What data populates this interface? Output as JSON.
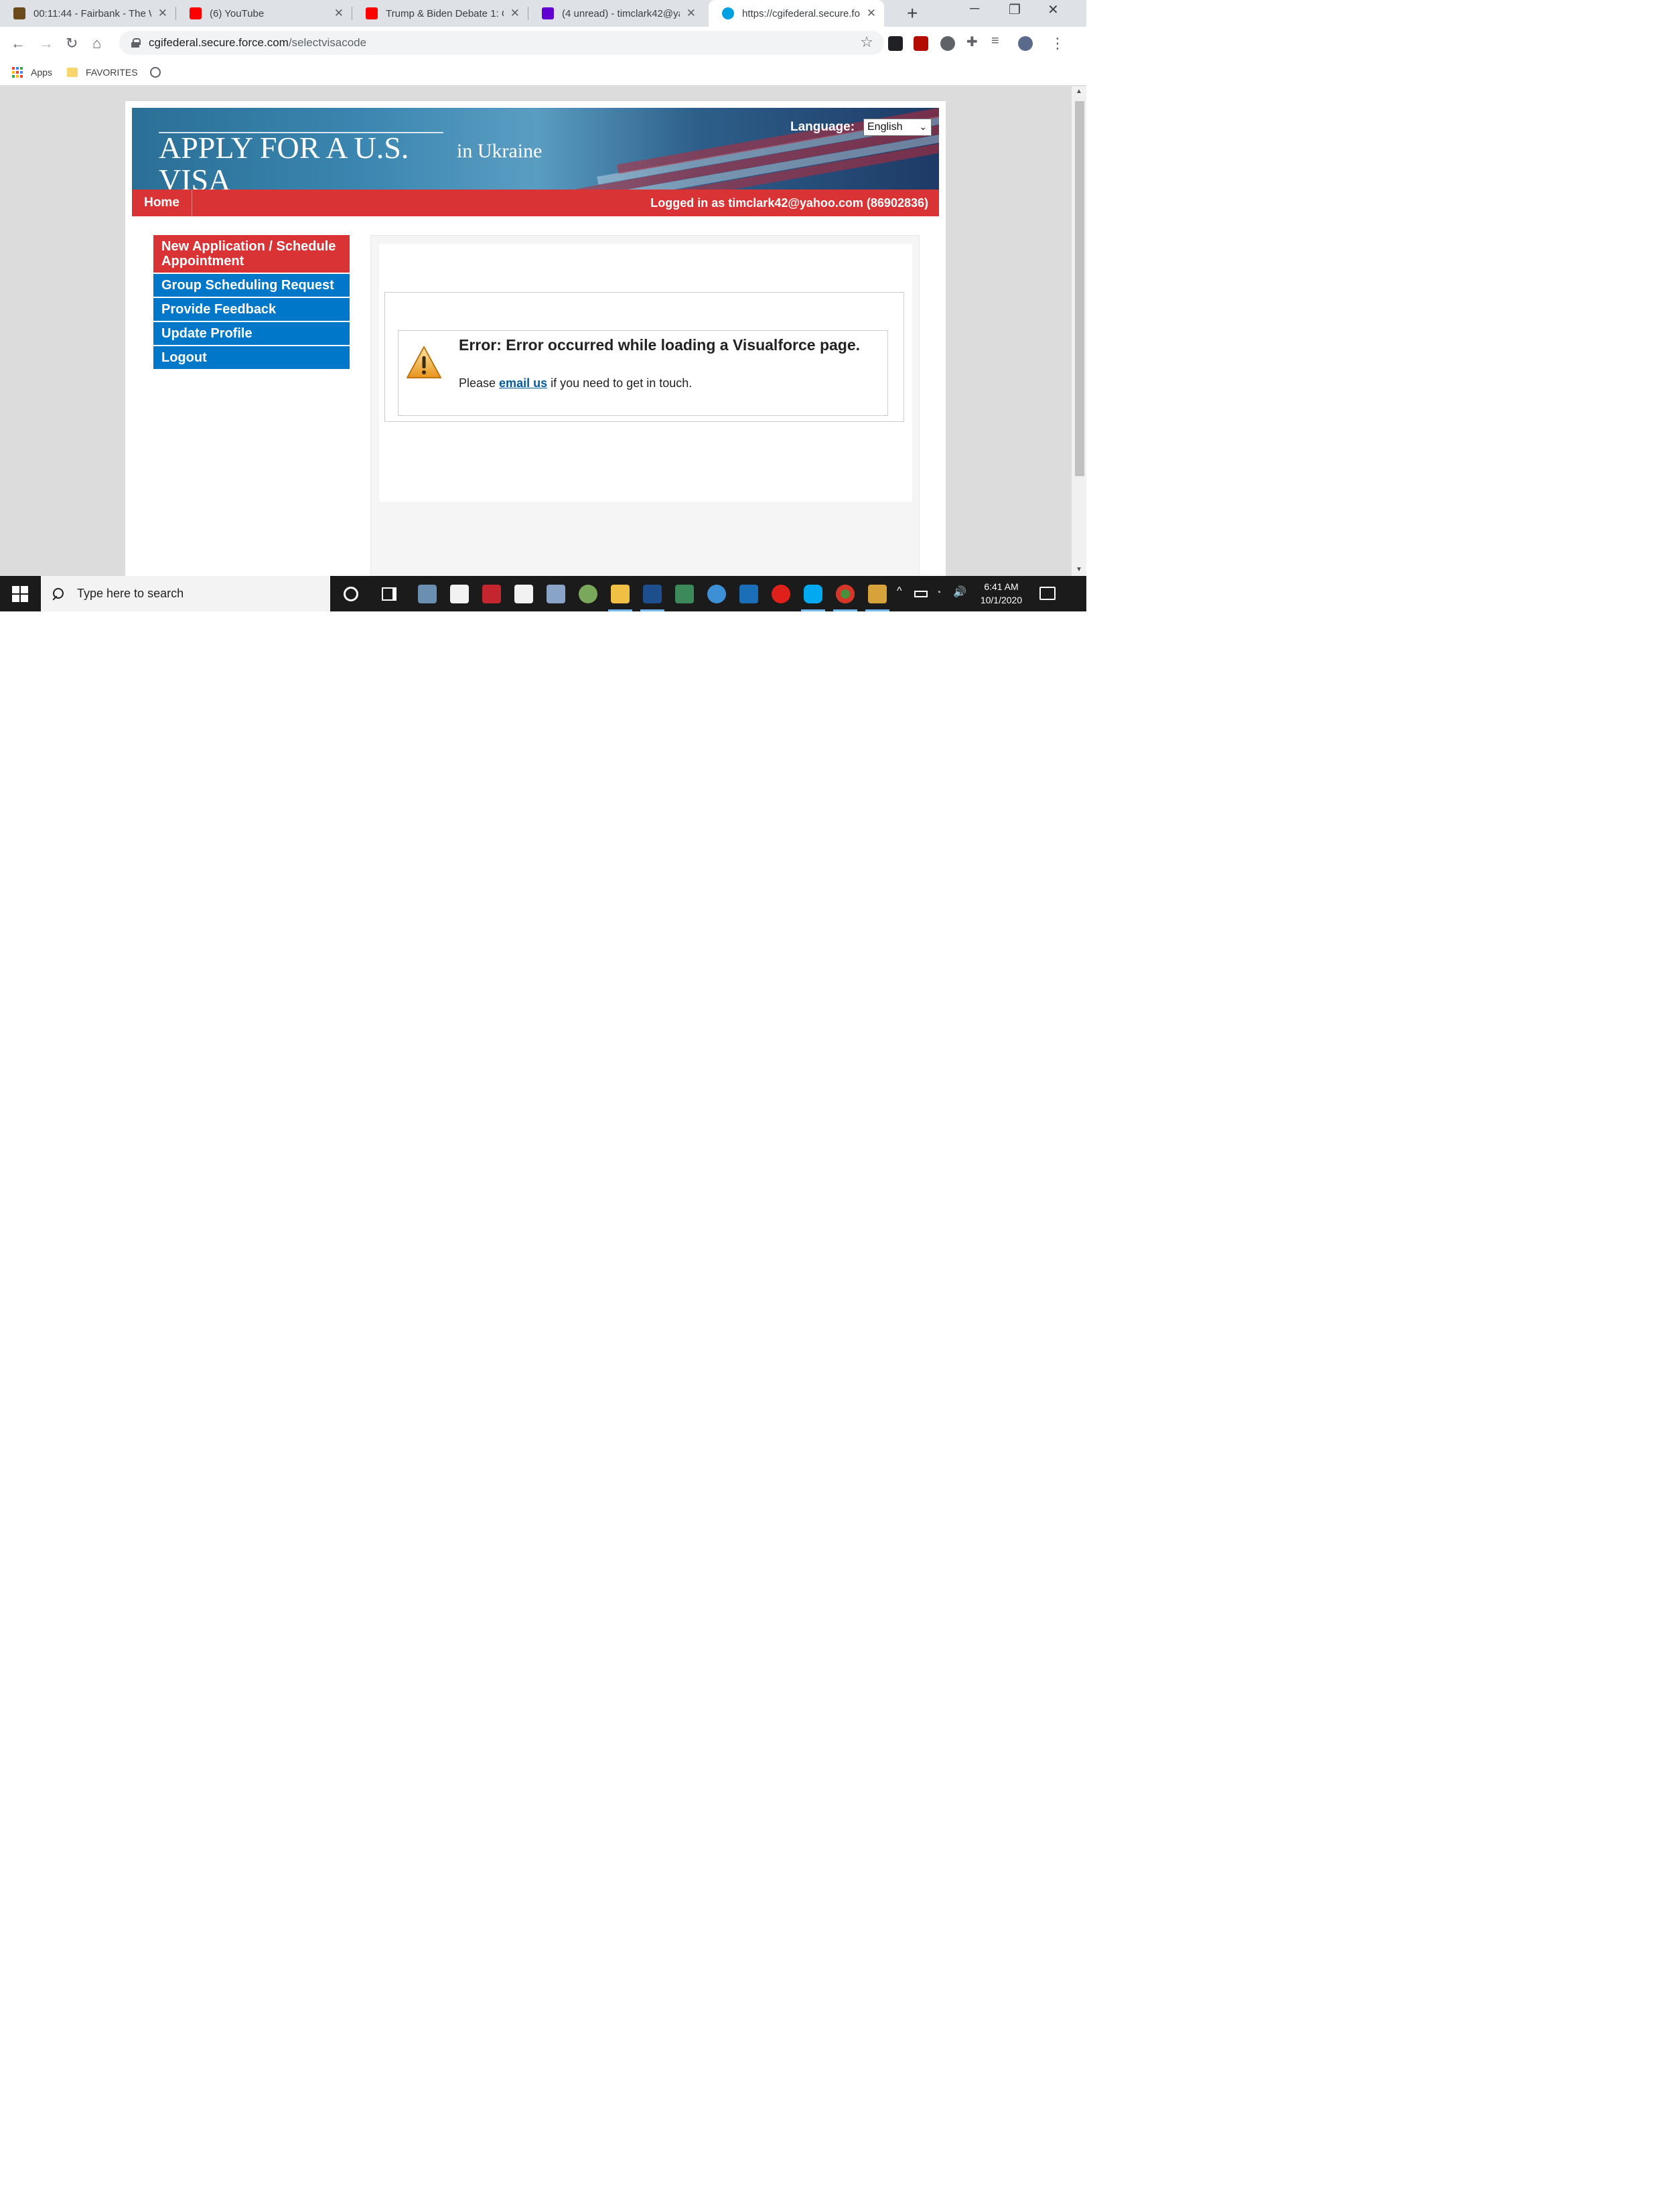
{
  "browser": {
    "tabs": [
      {
        "title": "00:11:44 - Fairbank - The W",
        "active": false,
        "favicon_color": "#6b4a1c"
      },
      {
        "title": "(6) YouTube",
        "active": false,
        "favicon_color": "#ff0000"
      },
      {
        "title": "Trump & Biden Debate 1: C",
        "active": false,
        "favicon_color": "#ff0000"
      },
      {
        "title": "(4 unread) - timclark42@ya",
        "active": false,
        "favicon_color": "#6001d2"
      },
      {
        "title": "https://cgifederal.secure.fo",
        "active": true,
        "favicon_color": "#00a1e0"
      }
    ],
    "tab_close": "✕",
    "new_tab": "+",
    "window_controls": {
      "minimize": "─",
      "restore": "❐",
      "close": "✕"
    },
    "url_host": "cgifederal.secure.force.com",
    "url_path": "/selectvisacode",
    "bookmarks": {
      "apps": "Apps",
      "favorites": "FAVORITES"
    },
    "icons": {
      "back": "←",
      "forward": "→",
      "reload": "↻",
      "home": "⌂",
      "star": "☆",
      "menu": "⋮",
      "extensions": "puzzle-icon"
    }
  },
  "site": {
    "banner_title": "APPLY FOR A U.S. VISA",
    "banner_country": "in  Ukraine",
    "language_label": "Language:",
    "language_value": "English",
    "home": "Home",
    "logged_in": "Logged in as  timclark42@yahoo.com (86902836)",
    "nav": [
      {
        "label": "New Application / Schedule Appointment",
        "current": true
      },
      {
        "label": "Group Scheduling Request",
        "current": false
      },
      {
        "label": "Provide Feedback",
        "current": false
      },
      {
        "label": "Update Profile",
        "current": false
      },
      {
        "label": "Logout",
        "current": false
      }
    ],
    "error_title": "Error: Error occurred while loading a Visualforce page.",
    "error_prefix": "Please ",
    "error_link": "email us",
    "error_suffix": " if you need to get in touch."
  },
  "colors": {
    "site_red": "#d93336",
    "site_blue": "#0077c8",
    "link": "#005a9c"
  },
  "taskbar": {
    "search_placeholder": "Type here to search",
    "time": "6:41 AM",
    "date": "10/1/2020",
    "tray_chevron": "^",
    "volume": "🔊"
  }
}
